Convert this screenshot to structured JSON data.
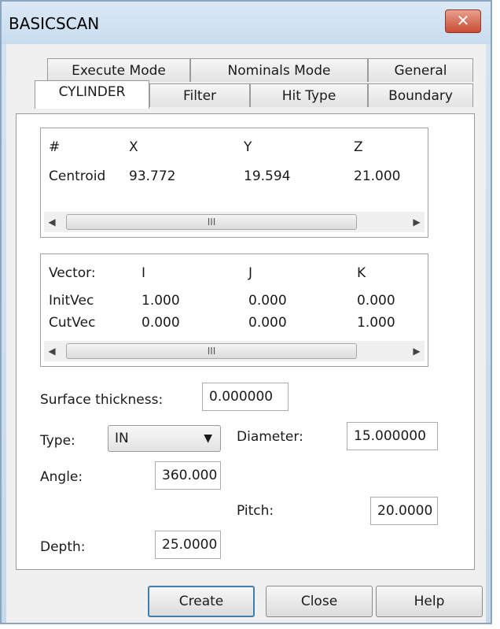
{
  "window": {
    "title": "BASICSCAN",
    "close_glyph": "✕"
  },
  "tabs_row1": [
    "Execute Mode",
    "Nominals Mode",
    "General"
  ],
  "tabs_row2": [
    "CYLINDER",
    "Filter",
    "Hit Type",
    "Boundary"
  ],
  "active_tab": "CYLINDER",
  "centroid_table": {
    "headers": [
      "#",
      "X",
      "Y",
      "Z"
    ],
    "rows": [
      [
        "Centroid",
        "93.772",
        "19.594",
        "21.000"
      ]
    ],
    "scroll_thumb_glyph": "III"
  },
  "vector_table": {
    "headers": [
      "Vector:",
      "I",
      "J",
      "K"
    ],
    "rows": [
      [
        "InitVec",
        "1.000",
        "0.000",
        "0.000"
      ],
      [
        "CutVec",
        "0.000",
        "0.000",
        "1.000"
      ]
    ],
    "scroll_thumb_glyph": "III"
  },
  "form": {
    "surface_thickness_label": "Surface thickness:",
    "surface_thickness_value": "0.000000",
    "type_label": "Type:",
    "type_value": "IN",
    "diameter_label": "Diameter:",
    "diameter_value": "15.000000",
    "angle_label": "Angle:",
    "angle_value": "360.000",
    "pitch_label": "Pitch:",
    "pitch_value": "20.0000",
    "depth_label": "Depth:",
    "depth_value": "25.0000"
  },
  "buttons": {
    "create": "Create",
    "close": "Close",
    "help": "Help"
  }
}
